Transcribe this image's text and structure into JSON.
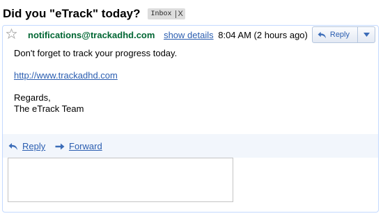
{
  "message": {
    "subject": "Did you \"eTrack\" today?",
    "label": "Inbox",
    "label_remove": "X",
    "sender": "notifications@trackadhd.com",
    "show_details": "show details",
    "time": "8:04 AM (2 hours ago)",
    "reply_button": "Reply",
    "body": {
      "line1": "Don't forget to track your progress today.",
      "link": "http://www.trackadhd.com",
      "regards": "Regards,",
      "signature": "The eTrack Team"
    },
    "footer": {
      "reply": "Reply",
      "forward": "Forward"
    },
    "reply_box": {
      "value": ""
    }
  },
  "colors": {
    "sender": "#006633",
    "link": "#2a5db0",
    "card_border": "#c3d9ff",
    "footer_bg": "#f2f6fc",
    "label_chip": "#dddddd"
  },
  "icons": {
    "star": "star-icon",
    "reply": "reply-arrow-icon",
    "forward": "forward-arrow-icon",
    "dropdown": "triangle-down-icon"
  }
}
